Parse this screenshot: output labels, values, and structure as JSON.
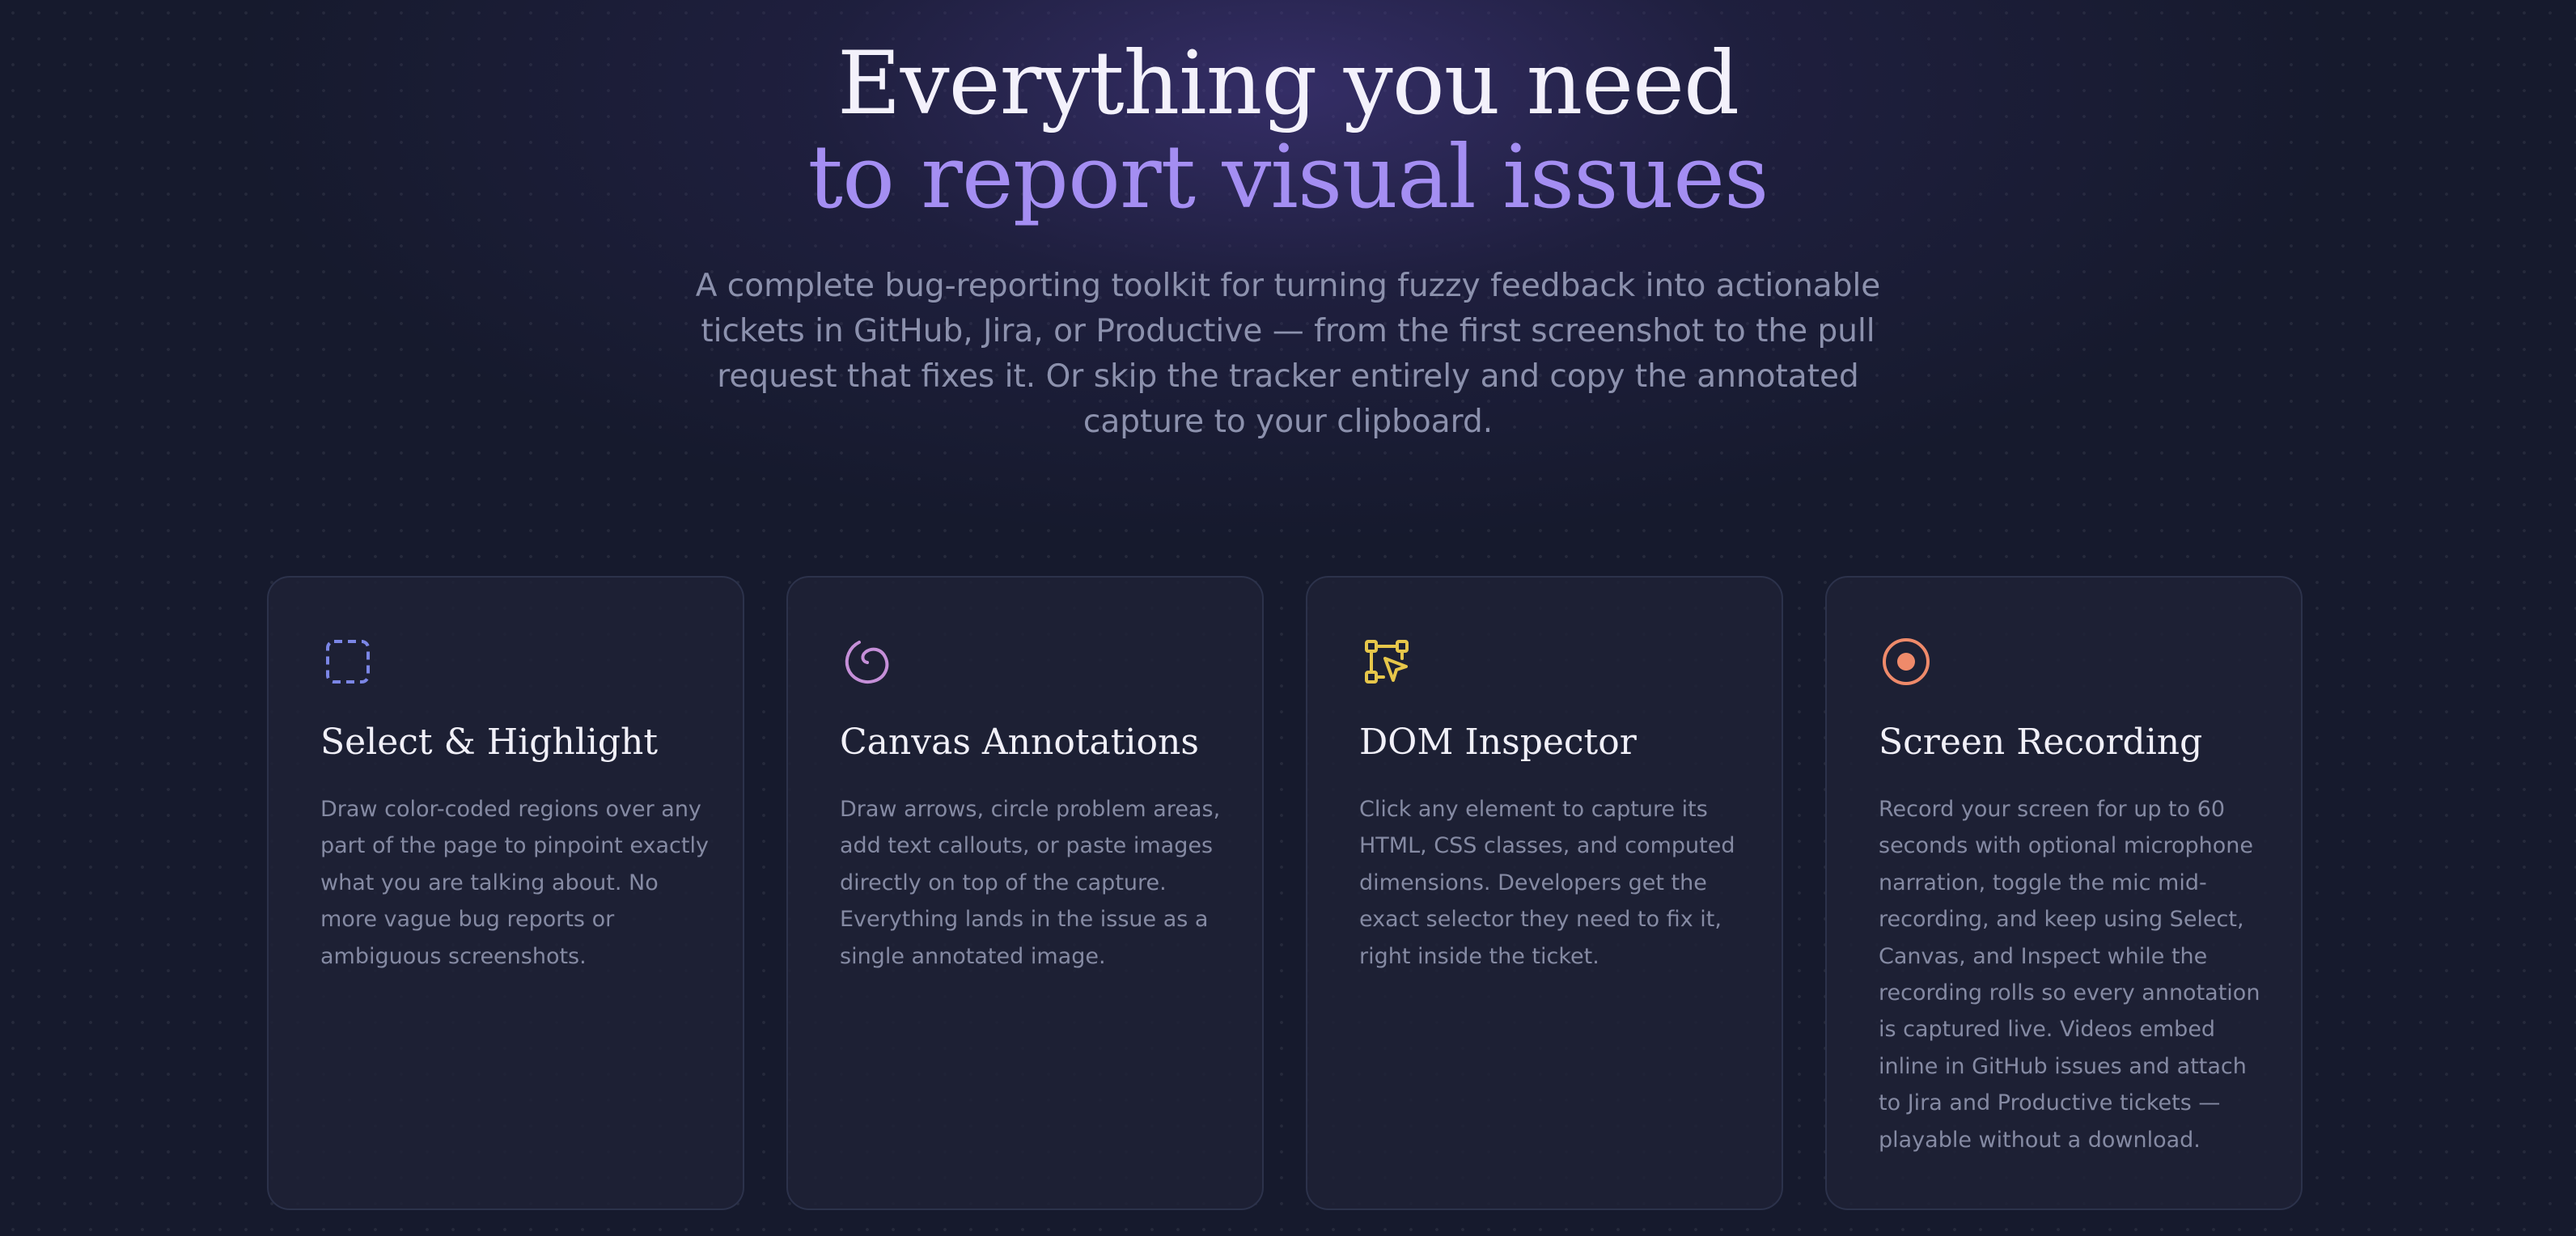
{
  "header": {
    "headline_line1": "Everything you need",
    "headline_line2": "to report visual issues",
    "subtitle": "A complete bug-reporting toolkit for turning fuzzy feedback into actionable tickets in GitHub, Jira, or Productive — from the first screenshot to the pull request that fixes it. Or skip the tracker entirely and copy the annotated capture to your clipboard."
  },
  "features": [
    {
      "icon": "dashed-square-icon",
      "icon_color": "#7b86e6",
      "title": "Select & Highlight",
      "description": "Draw color-coded regions over any part of the page to pinpoint exactly what you are talking about. No more vague bug reports or ambiguous screenshots."
    },
    {
      "icon": "circle-arrow-icon",
      "icon_color": "#c58fd8",
      "title": "Canvas Annotations",
      "description": "Draw arrows, circle problem areas, add text callouts, or paste images directly on top of the capture. Everything lands in the issue as a single annotated image."
    },
    {
      "icon": "element-cursor-icon",
      "icon_color": "#e6c64a",
      "title": "DOM Inspector",
      "description": "Click any element to capture its HTML, CSS classes, and computed dimensions. Developers get the exact selector they need to fix it, right inside the ticket."
    },
    {
      "icon": "record-icon",
      "icon_color": "#ef8a6a",
      "title": "Screen Recording",
      "description": "Record your screen for up to 60 seconds with optional microphone narration, toggle the mic mid-recording, and keep using Select, Canvas, and Inspect while the recording rolls so every annotation is captured live. Videos embed inline in GitHub issues and attach to Jira and Productive tickets — playable without a download."
    }
  ],
  "colors": {
    "background": "#161a2d",
    "headline": "#f3f1fb",
    "headline_accent": "#a48ef2",
    "body_text": "#8c91ad",
    "card_border": "#2c324b"
  }
}
